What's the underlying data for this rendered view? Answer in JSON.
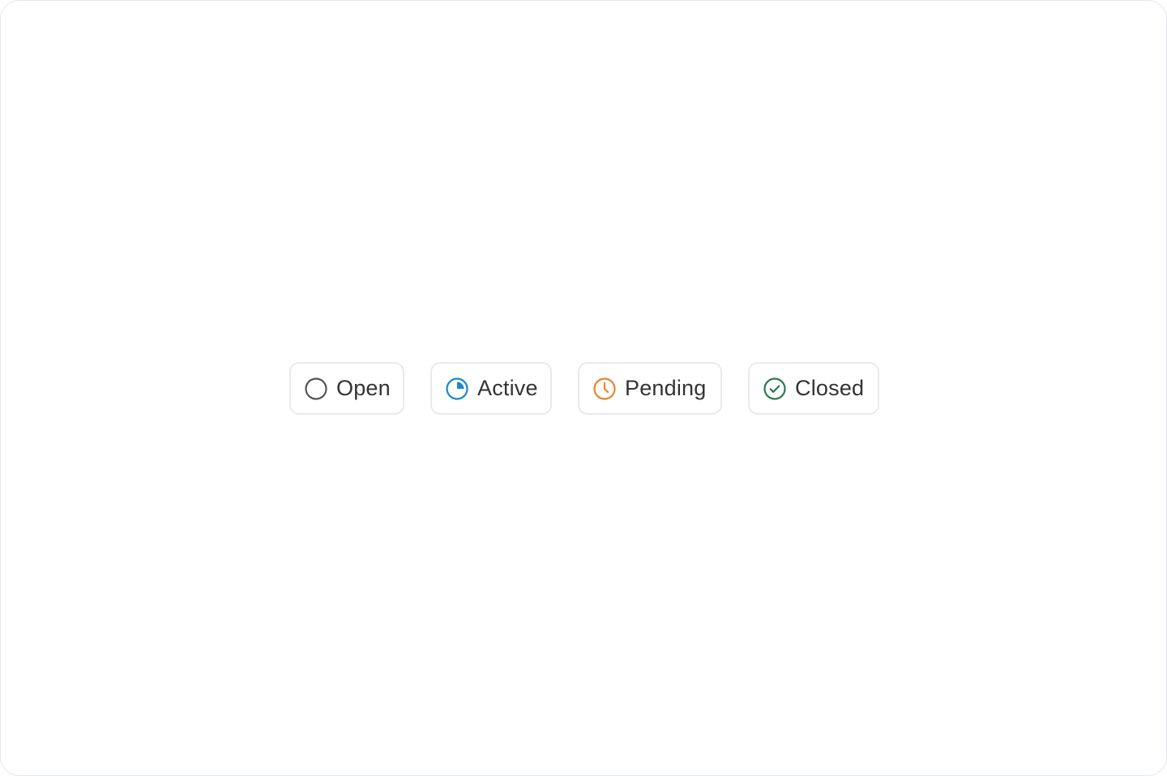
{
  "badges": [
    {
      "label": "Open",
      "icon": "circle-outline-icon",
      "color": "#555555"
    },
    {
      "label": "Active",
      "icon": "progress-pie-icon",
      "color": "#1a88c9"
    },
    {
      "label": "Pending",
      "icon": "clock-icon",
      "color": "#e8862d"
    },
    {
      "label": "Closed",
      "icon": "check-circle-icon",
      "color": "#2a7a4f"
    }
  ]
}
